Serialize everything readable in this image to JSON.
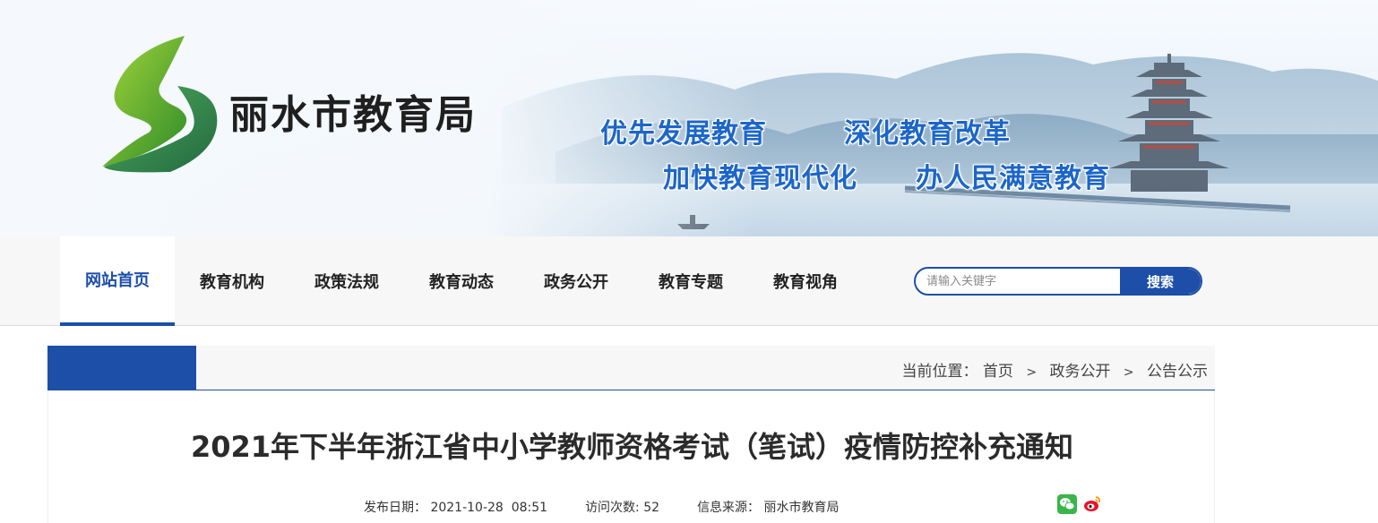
{
  "header": {
    "site_name": "丽水市教育局",
    "slogans": [
      "优先发展教育",
      "深化教育改革",
      "加快教育现代化",
      "办人民满意教育"
    ]
  },
  "nav": {
    "items": [
      {
        "label": "网站首页",
        "active": true
      },
      {
        "label": "教育机构"
      },
      {
        "label": "政策法规"
      },
      {
        "label": "教育动态"
      },
      {
        "label": "政务公开"
      },
      {
        "label": "教育专题"
      },
      {
        "label": "教育视角"
      }
    ],
    "search_placeholder": "请输入关键字",
    "search_button": "搜索"
  },
  "breadcrumb": {
    "prefix": "当前位置：",
    "items": [
      "首页",
      "政务公开",
      "公告公示"
    ],
    "separator": ">"
  },
  "article": {
    "title": "2021年下半年浙江省中小学教师资格考试（笔试）疫情防控补充通知",
    "publish_label": "发布日期：",
    "publish_date": "2021-10-28  08:51",
    "visits_label": "访问次数:",
    "visits": "52",
    "source_label": "信息来源：",
    "source": "丽水市教育局"
  },
  "share": {
    "icons": [
      "wechat-icon",
      "weibo-icon"
    ]
  },
  "colors": {
    "brand_blue": "#1d4ea8",
    "slogan_blue": "#1c66c9"
  }
}
